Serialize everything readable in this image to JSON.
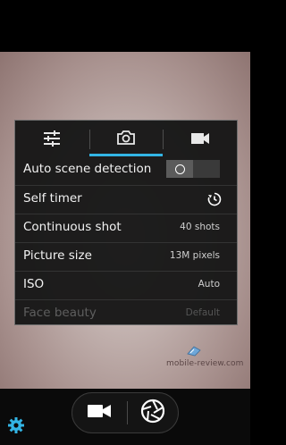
{
  "settings_panel": {
    "tabs": [
      {
        "icon": "sliders-icon",
        "active": false
      },
      {
        "icon": "photo-camera-icon",
        "active": true
      },
      {
        "icon": "video-camera-icon",
        "active": false
      }
    ],
    "rows": [
      {
        "label": "Auto scene detection",
        "control": "toggle",
        "state": "off"
      },
      {
        "label": "Self timer",
        "icon": "timer-icon"
      },
      {
        "label": "Continuous shot",
        "value": "40 shots"
      },
      {
        "label": "Picture size",
        "value": "13M pixels"
      },
      {
        "label": "ISO",
        "value": "Auto"
      },
      {
        "label": "Face beauty",
        "value": "Default",
        "disabled": true
      }
    ]
  },
  "watermark": {
    "text": "mobile-review.com"
  },
  "bottom_bar": {
    "settings_icon": "gear-icon",
    "video_icon": "video-camera-icon",
    "shutter_icon": "aperture-shutter-icon"
  },
  "colors": {
    "accent": "#33b5e5",
    "panel_bg": "#161616",
    "text": "#f2f2f2",
    "disabled_text": "#5e5e5e"
  }
}
